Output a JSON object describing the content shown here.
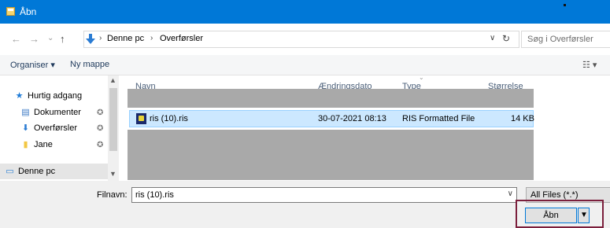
{
  "window": {
    "title": "Åbn"
  },
  "nav": {
    "back": "←",
    "forward": "→",
    "recent": "⌄",
    "up": "↑"
  },
  "address": {
    "segments": [
      "Denne pc",
      "Overførsler"
    ],
    "separator": "›",
    "dropdown": "∨",
    "refresh": "↻"
  },
  "search": {
    "placeholder": "Søg i Overførsler"
  },
  "toolbar": {
    "organize": "Organiser ▾",
    "new_folder": "Ny mappe",
    "view_icon": "☷ ▾"
  },
  "sidebar": {
    "items": [
      {
        "label": "Hurtig adgang",
        "icon": "star-icon",
        "glyph": "★",
        "color": "#1e7bd7"
      },
      {
        "label": "Dokumenter",
        "icon": "documents-icon",
        "glyph": "▤",
        "color": "#3b78c4"
      },
      {
        "label": "Overførsler",
        "icon": "downloads-icon",
        "glyph": "⬇",
        "color": "#2b7cd3"
      },
      {
        "label": "Jane",
        "icon": "folder-icon",
        "glyph": "▮",
        "color": "#f2c744"
      },
      {
        "label": "Denne pc",
        "icon": "computer-icon",
        "glyph": "▭",
        "color": "#2a7fd4"
      }
    ],
    "pin": "✪"
  },
  "columns": {
    "name": "Navn",
    "date": "Ændringsdato",
    "type": "Type",
    "size": "Størrelse"
  },
  "files": [
    {
      "name": "ris (10).ris",
      "date": "30-07-2021 08:13",
      "type": "RIS Formatted File",
      "size": "14 KB"
    }
  ],
  "bottom": {
    "filename_label": "Filnavn:",
    "filename_value": "ris (10).ris",
    "filter": "All Files (*.*)",
    "open_label": "Åbn",
    "open_split": "▼"
  },
  "colors": {
    "titlebar": "#0078d7",
    "highlight_border": "#7b1f3c",
    "selected_row": "#cce8ff"
  }
}
